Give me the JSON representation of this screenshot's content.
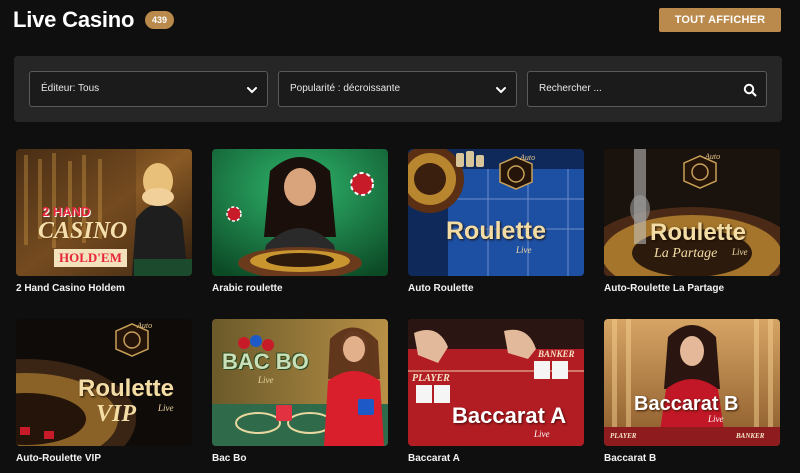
{
  "header": {
    "title": "Live Casino",
    "count": "439",
    "show_all_label": "TOUT AFFICHER"
  },
  "filters": {
    "editor_label": "Éditeur: Tous",
    "popularity_label": "Popularité : décroissante",
    "search_placeholder": "Rechercher ..."
  },
  "games": [
    {
      "name": "2 Hand Casino Holdem",
      "thumb_text": [
        "2 HAND",
        "CASINO",
        "HOLD'EM"
      ]
    },
    {
      "name": "Arabic roulette",
      "thumb_text": []
    },
    {
      "name": "Auto Roulette",
      "thumb_text": [
        "Auto",
        "Roulette",
        "Live"
      ]
    },
    {
      "name": "Auto-Roulette La Partage",
      "thumb_text": [
        "Auto",
        "Roulette",
        "La Partage",
        "Live"
      ]
    },
    {
      "name": "Auto-Roulette VIP",
      "thumb_text": [
        "Auto",
        "Roulette",
        "VIP",
        "Live"
      ]
    },
    {
      "name": "Bac Bo",
      "thumb_text": [
        "BAC BO",
        "Live"
      ]
    },
    {
      "name": "Baccarat A",
      "thumb_text": [
        "PLAYER",
        "BANKER",
        "Baccarat A",
        "Live"
      ]
    },
    {
      "name": "Baccarat B",
      "thumb_text": [
        "Baccarat B",
        "Live",
        "PLAYER",
        "BANKER"
      ]
    }
  ],
  "colors": {
    "accent": "#b98a4c",
    "background": "#0f0f0f",
    "panel": "#262626"
  }
}
